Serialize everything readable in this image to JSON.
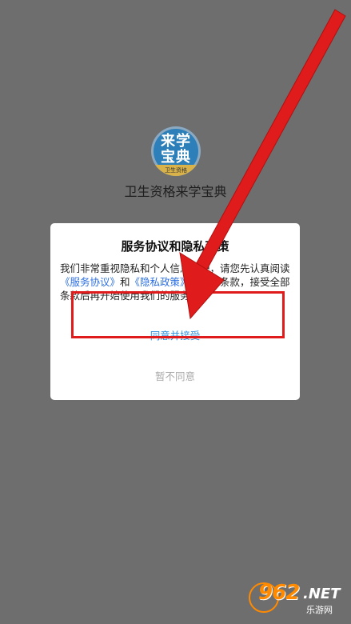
{
  "app": {
    "logo_top": "来学",
    "logo_bottom": "宝典",
    "logo_band": "卫生资格",
    "name": "卫生资格来学宝典"
  },
  "dialog": {
    "title": "服务协议和隐私政策",
    "body_part1": "我们非常重视隐私和个人信息保护，请您先认真阅读",
    "service_link": "《服务协议》",
    "body_part2": "和",
    "privacy_link": "《隐私政策》",
    "body_part3": "的全部条款，接受全部条款后再开始使用我们的服务。",
    "agree_label": "同意并接受",
    "decline_label": "暂不同意"
  },
  "colors": {
    "backdrop": "#6e6e6e",
    "link": "#2d6fe0",
    "agree": "#2d8fdc",
    "decline": "#aaaaaa",
    "annotation": "#e01b1b"
  },
  "watermark": {
    "number": "962",
    "domain": ".NET",
    "site": "乐游网"
  }
}
